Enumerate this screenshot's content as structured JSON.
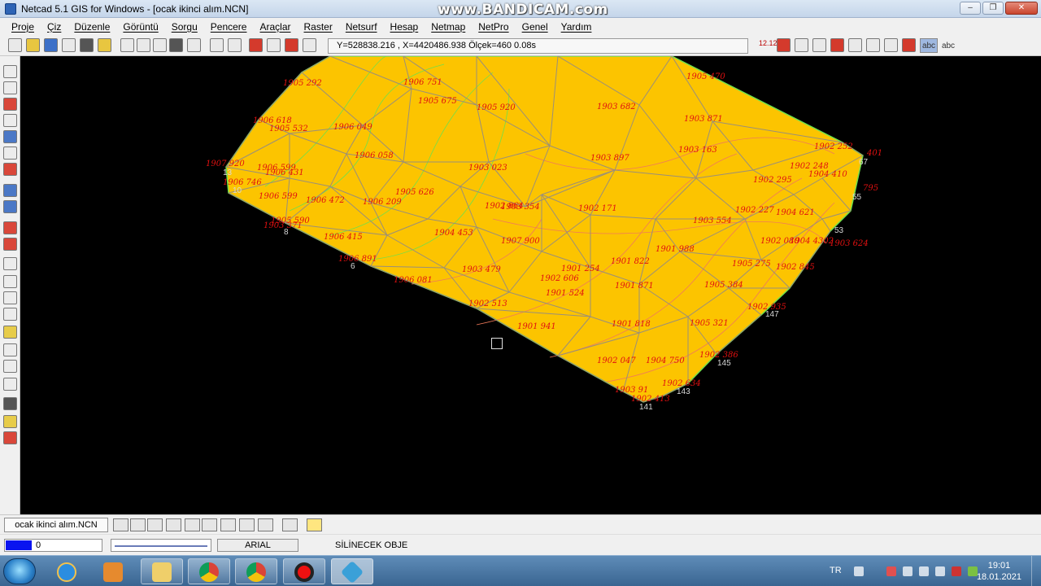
{
  "window": {
    "title": "Netcad 5.1 GIS for Windows - [ocak ikinci alım.NCN]",
    "watermark": "www.BANDICAM.com"
  },
  "menu": [
    "Proje",
    "Çiz",
    "Düzenle",
    "Görüntü",
    "Sorgu",
    "Pencere",
    "Araçlar",
    "Raster",
    "Netsurf",
    "Hesap",
    "Netmap",
    "NetPro",
    "Genel",
    "Yardım"
  ],
  "toolbar": {
    "coordinates": "Y=528838.216 , X=4420486.938 Ölçek=460   0.08s",
    "right_labels": [
      "12.12",
      "abc",
      "abc"
    ]
  },
  "drawing": {
    "fill_color": "#fcc400",
    "tin_color": "#9a8f7a",
    "contour_color": "#f07a5a",
    "contour_edge_color": "#6fe04a",
    "label_color": "#e01010",
    "labels": [
      "1905 292",
      "1906 751",
      "1905 675",
      "1905 920",
      "1905 470",
      "1906 618",
      "1905 532",
      "1906 049",
      "1903 682",
      "1903 871",
      "1907 920",
      "1906 746",
      "1906 599",
      "1906 431",
      "1906 058",
      "1903 023",
      "1903 897",
      "1903 163",
      "1902 252",
      "401",
      "1906 599",
      "1906 472",
      "1906 209",
      "1905 626",
      "1902 864",
      "1902 295",
      "1902 248",
      "1904 410",
      "795",
      "1905 590",
      "1906 415",
      "1904 453",
      "1903 354",
      "1902 171",
      "1902 227",
      "1904 621",
      "1903 371",
      "1907 900",
      "1903 554",
      "1902 080",
      "1904 4302",
      "1903 624",
      "1906 891",
      "1903 479",
      "1901 988",
      "1905 275",
      "1902 845",
      "1906 081",
      "1902 606",
      "1901 254",
      "1901 822",
      "1901 871",
      "1905 384",
      "1902 513",
      "1901 524",
      "1902 935",
      "1901 941",
      "1901 818",
      "1905 321",
      "1902 047",
      "1904 750",
      "1902 386",
      "1903 91",
      "1902 634",
      "1902 413"
    ],
    "point_numbers": [
      "13",
      "10",
      "8",
      "6",
      "67",
      "55",
      "53",
      "147",
      "145",
      "143",
      "141"
    ]
  },
  "layerbar": {
    "layer_name": "ocak ikinci alım.NCN"
  },
  "statusbar": {
    "color_value": "0",
    "font": "ARIAL",
    "message": "SİLİNECEK OBJE"
  },
  "taskbar": {
    "language": "TR",
    "time": "19:01",
    "date": "18.01.2021"
  }
}
